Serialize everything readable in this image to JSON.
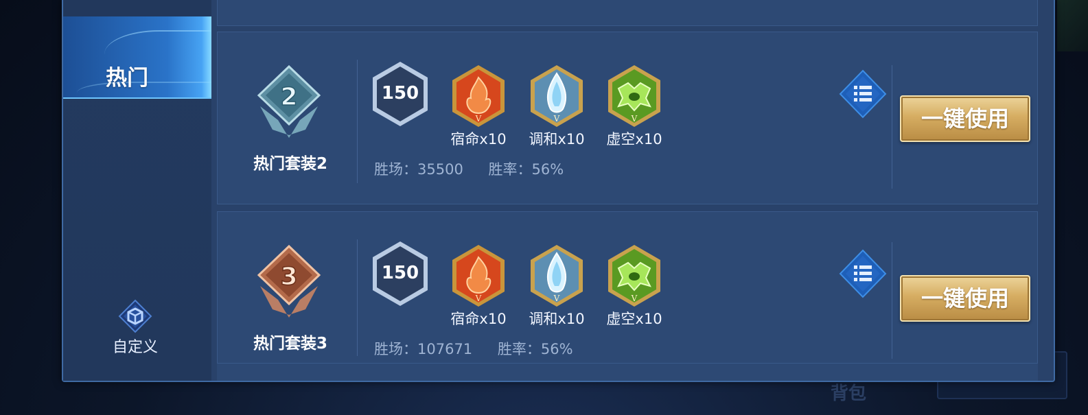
{
  "background": {
    "bottom_label": "背包",
    "accent_color": "#0c1629"
  },
  "sidebar": {
    "active_tab": "热门",
    "custom_label": "自定义",
    "active_color": "#2a73c8"
  },
  "sets": [
    {
      "name": "热门套装2",
      "rank": "2",
      "rank_color": "silver",
      "level": "150",
      "inscriptions": [
        {
          "label": "宿命x10",
          "icon": "fire-inscription-icon",
          "color": "#d6471d"
        },
        {
          "label": "调和x10",
          "icon": "water-inscription-icon",
          "color": "#7fb3d6"
        },
        {
          "label": "虚空x10",
          "icon": "void-inscription-icon",
          "color": "#6fb52e"
        }
      ],
      "wins": "胜场：35500",
      "winrate": "胜率：56%",
      "use_label": "一键使用"
    },
    {
      "name": "热门套装3",
      "rank": "3",
      "rank_color": "bronze",
      "level": "150",
      "inscriptions": [
        {
          "label": "宿命x10",
          "icon": "fire-inscription-icon",
          "color": "#d6471d"
        },
        {
          "label": "调和x10",
          "icon": "water-inscription-icon",
          "color": "#7fb3d6"
        },
        {
          "label": "虚空x10",
          "icon": "void-inscription-icon",
          "color": "#6fb52e"
        }
      ],
      "wins": "胜场：107671",
      "winrate": "胜率：56%",
      "use_label": "一键使用"
    }
  ],
  "colors": {
    "panel": "#29426a",
    "card": "#2d4974",
    "button_gold": "#d6ad62"
  }
}
